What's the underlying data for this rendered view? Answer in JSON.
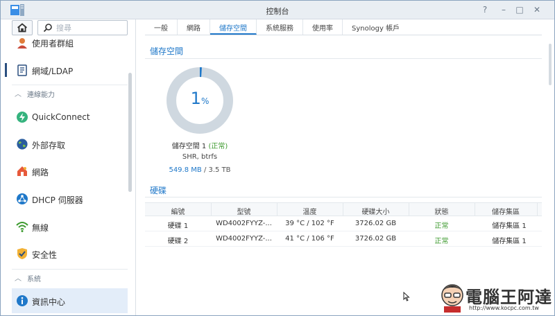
{
  "window": {
    "title": "控制台",
    "controls": [
      "?",
      "–",
      "□",
      "✕"
    ]
  },
  "search": {
    "placeholder": "搜尋"
  },
  "sidebar": {
    "items_top": [
      {
        "label": "使用者群組",
        "icon": "users-icon"
      },
      {
        "label": "網域/LDAP",
        "icon": "directory-icon"
      }
    ],
    "section_connectivity": "連線能力",
    "items_conn": [
      {
        "label": "QuickConnect",
        "icon": "quickconnect-icon"
      },
      {
        "label": "外部存取",
        "icon": "globe-icon"
      },
      {
        "label": "網路",
        "icon": "network-icon"
      },
      {
        "label": "DHCP 伺服器",
        "icon": "dhcp-icon"
      },
      {
        "label": "無線",
        "icon": "wifi-icon"
      },
      {
        "label": "安全性",
        "icon": "shield-icon"
      }
    ],
    "section_system": "系統",
    "items_sys": [
      {
        "label": "資訊中心",
        "icon": "info-icon"
      }
    ]
  },
  "tabs": [
    "一般",
    "網路",
    "儲存空間",
    "系統服務",
    "使用率",
    "Synology 帳戶"
  ],
  "active_tab": "儲存空間",
  "storage": {
    "heading": "儲存空間",
    "usage_percent": 1,
    "usage_num": "1",
    "usage_unit": "%",
    "volume_name": "儲存空間 1",
    "volume_status": "(正常)",
    "fs": "SHR, btrfs",
    "used": "549.8 MB",
    "total": "/ 3.5 TB",
    "colors": {
      "ring": "#cfd8e0",
      "used": "#1f78c9"
    }
  },
  "disks": {
    "heading": "硬碟",
    "columns": [
      "編號",
      "型號",
      "溫度",
      "硬碟大小",
      "狀態",
      "儲存集區"
    ],
    "rows": [
      [
        "硬碟 1",
        "WD4002FYYZ-...",
        "39 °C / 102 °F",
        "3726.02 GB",
        "正常",
        "儲存集區 1"
      ],
      [
        "硬碟 2",
        "WD4002FYYZ-...",
        "41 °C / 106 °F",
        "3726.02 GB",
        "正常",
        "儲存集區 1"
      ]
    ]
  },
  "watermark": {
    "text": "電腦王阿達",
    "url": "http://www.kocpc.com.tw"
  }
}
